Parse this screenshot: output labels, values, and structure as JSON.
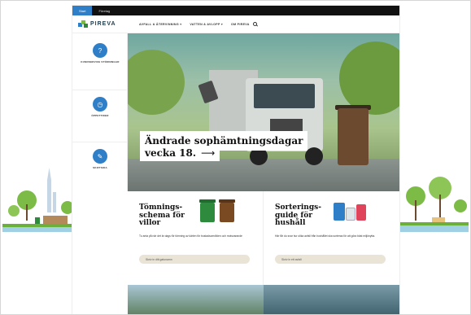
{
  "topbar": {
    "tabs": [
      {
        "label": "Start",
        "active": true
      },
      {
        "label": "Företag",
        "active": false
      }
    ]
  },
  "nav": {
    "logo_text": "PIREVA",
    "links": [
      "AVFALL & ÅTERVINNING ▾",
      "VATTEN & AVLOPP ▾",
      "OM PIREVA"
    ],
    "search_icon": "search-icon"
  },
  "quick": [
    {
      "label": "KUNDSERVICE STÖRNINGAR",
      "icon": "chat-icon",
      "glyph": "?"
    },
    {
      "label": "ÖPPETTIDER",
      "icon": "clock-icon",
      "glyph": "◷"
    },
    {
      "label": "SKIFTSIDA",
      "icon": "wrench-icon",
      "glyph": "✎"
    }
  ],
  "hero": {
    "line1": "Ändrade sophämtningsdagar",
    "line2": "vecka 18.",
    "arrow": "⟶"
  },
  "cards": [
    {
      "title": "Tömnings-schema för villor",
      "desc": "Tu anta på när det är dags för tömning av kärlen för bostadsområden och motsvarande",
      "placeholder": "Skriv in ditt gatunamn"
    },
    {
      "title": "Sorterings-guide för hushåll",
      "desc": "Här får du svar hur olika avfall från hushållet ska sorteras för att göra bäst miljönytta.",
      "placeholder": "Skriv in ett avfall"
    }
  ],
  "colors": {
    "accent": "#2f7fc8",
    "topbar": "#111111",
    "bin_green": "#2e8b3e",
    "bin_brown": "#7a4a22"
  }
}
